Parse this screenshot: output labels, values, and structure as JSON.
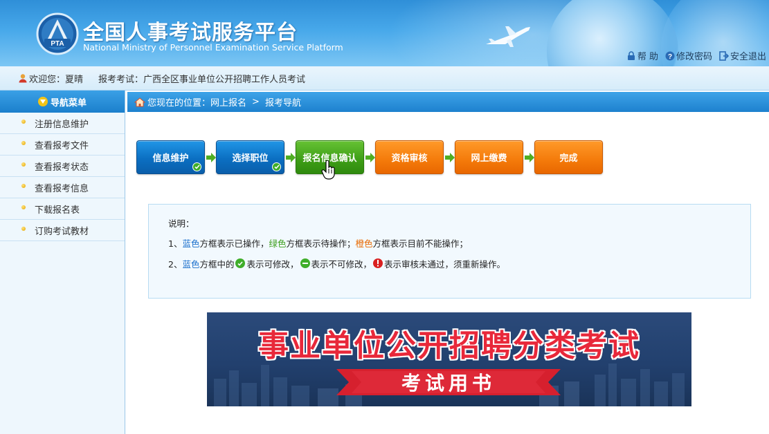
{
  "header": {
    "title": "全国人事考试服务平台",
    "subtitle": "National Ministry of Personnel Examination Service Platform",
    "logo_text": "PTA",
    "links": [
      {
        "label": "帮 助",
        "icon": "lock-icon"
      },
      {
        "label": "修改密码",
        "icon": "question-icon"
      },
      {
        "label": "安全退出",
        "icon": "logout-icon"
      }
    ]
  },
  "welcome": {
    "greeting_label": "欢迎您：",
    "user_name": "夏晴",
    "exam_label": "报考考试：",
    "exam_name": "广西全区事业单位公开招聘工作人员考试"
  },
  "sidebar": {
    "title": "导航菜单",
    "items": [
      {
        "label": "注册信息维护"
      },
      {
        "label": "查看报考文件"
      },
      {
        "label": "查看报考状态"
      },
      {
        "label": "查看报考信息"
      },
      {
        "label": "下载报名表"
      },
      {
        "label": "订购考试教材"
      }
    ]
  },
  "breadcrumb": {
    "prefix": "您现在的位置：",
    "level1": "网上报名",
    "separator": ">",
    "level2": "报考导航"
  },
  "steps": [
    {
      "label": "信息维护",
      "state": "blue",
      "done": true
    },
    {
      "label": "选择职位",
      "state": "blue",
      "done": true
    },
    {
      "label": "报名信息确认",
      "state": "green",
      "done": false
    },
    {
      "label": "资格审核",
      "state": "orange",
      "done": false
    },
    {
      "label": "网上缴费",
      "state": "orange",
      "done": false
    },
    {
      "label": "完成",
      "state": "orange",
      "done": false
    }
  ],
  "info": {
    "heading": "说明：",
    "line1": {
      "num": "1、",
      "blue": "蓝色",
      "t1": "方框表示已操作，",
      "green": "绿色",
      "t2": "方框表示待操作；",
      "orange": "橙色",
      "t3": "方框表示目前不能操作；"
    },
    "line2": {
      "num": "2、",
      "blue": "蓝色",
      "t1": "方框中的",
      "t2": "表示可修改，",
      "t3": "表示不可修改，",
      "t4": "表示审核未通过，须重新操作。"
    }
  },
  "banner": {
    "headline": "事业单位公开招聘分类考试",
    "ribbon": "考试用书"
  },
  "colors": {
    "header": "#3a9ae0",
    "blue_step": "#0b6fc2",
    "green_step": "#3d9d16",
    "orange_step": "#f47a0a",
    "banner_red": "#e8283a"
  }
}
